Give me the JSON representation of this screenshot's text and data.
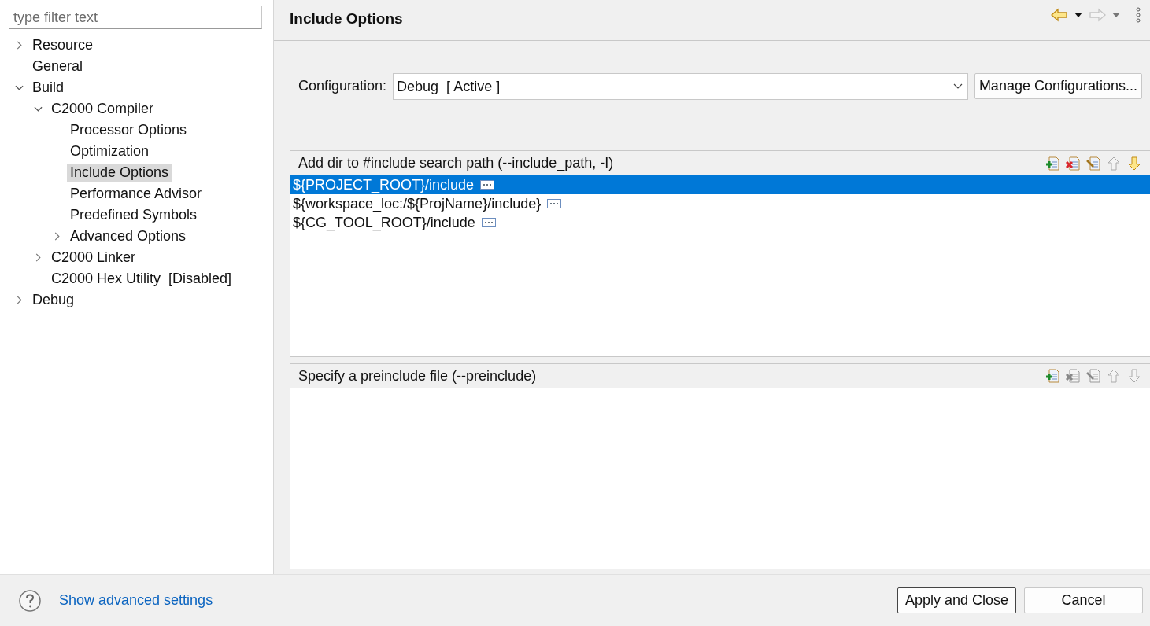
{
  "filter": {
    "placeholder": "type filter text"
  },
  "tree": [
    {
      "label": "Resource",
      "kind": "branch",
      "expanded": false,
      "selected": false
    },
    {
      "label": "General",
      "kind": "leaf",
      "selected": false
    },
    {
      "label": "Build",
      "kind": "branch",
      "expanded": true,
      "selected": false,
      "children": [
        {
          "label": "C2000 Compiler",
          "kind": "branch",
          "expanded": true,
          "selected": false,
          "children": [
            {
              "label": "Processor Options",
              "kind": "leaf",
              "selected": false
            },
            {
              "label": "Optimization",
              "kind": "leaf",
              "selected": false
            },
            {
              "label": "Include Options",
              "kind": "leaf",
              "selected": true
            },
            {
              "label": "Performance Advisor",
              "kind": "leaf",
              "selected": false
            },
            {
              "label": "Predefined Symbols",
              "kind": "leaf",
              "selected": false
            },
            {
              "label": "Advanced Options",
              "kind": "branch",
              "expanded": false,
              "selected": false
            }
          ]
        },
        {
          "label": "C2000 Linker",
          "kind": "branch",
          "expanded": false,
          "selected": false
        },
        {
          "label": "C2000 Hex Utility  [Disabled]",
          "kind": "leaf",
          "selected": false
        }
      ]
    },
    {
      "label": "Debug",
      "kind": "branch",
      "expanded": false,
      "selected": false
    }
  ],
  "page": {
    "title": "Include Options"
  },
  "configuration": {
    "label": "Configuration:",
    "value": "Debug  [ Active ]",
    "manage_button": "Manage Configurations..."
  },
  "lists": [
    {
      "title": "Add dir to #include search path (--include_path, -I)",
      "tools": [
        {
          "kind": "add",
          "disabled": false
        },
        {
          "kind": "delete",
          "disabled": false
        },
        {
          "kind": "edit",
          "disabled": false
        },
        {
          "kind": "up",
          "disabled": true
        },
        {
          "kind": "down",
          "disabled": false
        }
      ],
      "rows": [
        {
          "text": "${PROJECT_ROOT}/include",
          "selected": true
        },
        {
          "text": "${workspace_loc:/${ProjName}/include}",
          "selected": false
        },
        {
          "text": "${CG_TOOL_ROOT}/include",
          "selected": false
        }
      ]
    },
    {
      "title": "Specify a preinclude file (--preinclude)",
      "tools": [
        {
          "kind": "add",
          "disabled": false
        },
        {
          "kind": "delete",
          "disabled": true
        },
        {
          "kind": "edit",
          "disabled": true
        },
        {
          "kind": "up",
          "disabled": true
        },
        {
          "kind": "down",
          "disabled": true
        }
      ]
    }
  ],
  "footer": {
    "link": "Show advanced settings",
    "buttons": [
      {
        "label": "Apply and Close",
        "kind": "default"
      },
      {
        "label": "Cancel",
        "kind": "normal"
      }
    ]
  }
}
